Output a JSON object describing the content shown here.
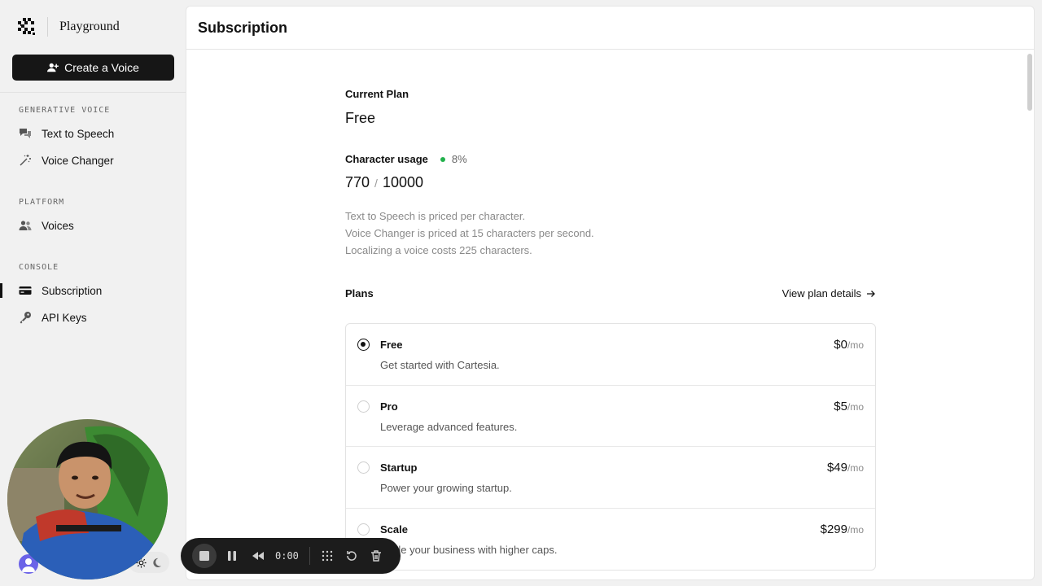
{
  "brand": {
    "name": "Playground"
  },
  "sidebar": {
    "create_label": "Create a Voice",
    "sections": [
      {
        "title": "GENERATIVE VOICE",
        "items": [
          {
            "label": "Text to Speech",
            "icon": "speech-bubbles-icon"
          },
          {
            "label": "Voice Changer",
            "icon": "magic-wand-icon"
          }
        ]
      },
      {
        "title": "PLATFORM",
        "items": [
          {
            "label": "Voices",
            "icon": "users-icon"
          }
        ]
      },
      {
        "title": "CONSOLE",
        "items": [
          {
            "label": "Subscription",
            "icon": "credit-card-icon",
            "active": true
          },
          {
            "label": "API Keys",
            "icon": "key-icon"
          }
        ]
      }
    ]
  },
  "main": {
    "title": "Subscription",
    "current_plan_label": "Current Plan",
    "current_plan": "Free",
    "usage_label": "Character usage",
    "usage_percent": "8%",
    "usage_used": "770",
    "usage_sep": "/",
    "usage_total": "10000",
    "usage_fraction": 0.077,
    "notes": [
      "Text to Speech is priced per character.",
      "Voice Changer is priced at 15 characters per second.",
      "Localizing a voice costs 225 characters."
    ],
    "plans_label": "Plans",
    "view_details": "View plan details",
    "plans": [
      {
        "name": "Free",
        "desc": "Get started with Cartesia.",
        "price": "$0",
        "per": "/mo",
        "selected": true
      },
      {
        "name": "Pro",
        "desc": "Leverage advanced features.",
        "price": "$5",
        "per": "/mo",
        "selected": false
      },
      {
        "name": "Startup",
        "desc": "Power your growing startup.",
        "price": "$49",
        "per": "/mo",
        "selected": false
      },
      {
        "name": "Scale",
        "desc": "Scale your business with higher caps.",
        "price": "$299",
        "per": "/mo",
        "selected": false
      }
    ]
  },
  "recorder": {
    "time": "0:00"
  },
  "colors": {
    "accent": "#161616",
    "usage_dot": "#22b14c",
    "avatar": "#6b63e8"
  }
}
